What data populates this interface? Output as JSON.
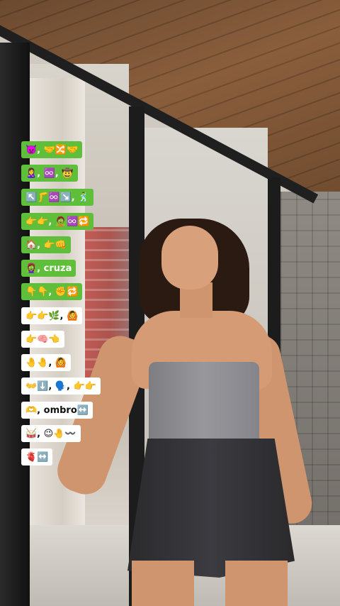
{
  "captions": [
    {
      "text": "👿, 🤝🔀🤝",
      "style": "green"
    },
    {
      "text": "🙎‍♀️, ♾️, 🤠",
      "style": "green"
    },
    {
      "text": "↖️🦵♾️↘️, 🕺",
      "style": "green"
    },
    {
      "text": "👉👉, 🧟♾️🔁",
      "style": "green"
    },
    {
      "text": "🏠, 👉👊",
      "style": "green"
    },
    {
      "text": "🧟‍♀️, cruza",
      "style": "green"
    },
    {
      "text": "👇👇, ✊🔁",
      "style": "green"
    },
    {
      "text": "👉👉🌿, 🙆",
      "style": "white"
    },
    {
      "text": "👉🧠👈",
      "style": "white"
    },
    {
      "text": "🤚🤚, 🙆",
      "style": "white"
    },
    {
      "text": "👐⬇️, 🗣️, 👉👉",
      "style": "white"
    },
    {
      "text": "🫶, ombro↔️",
      "style": "white"
    },
    {
      "text": "🥁, 😉🤚〰️",
      "style": "white"
    },
    {
      "text": "🫀↔️",
      "style": "white"
    }
  ]
}
